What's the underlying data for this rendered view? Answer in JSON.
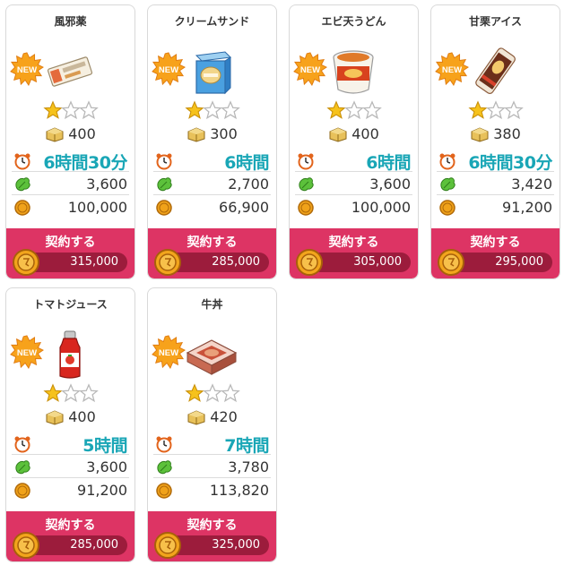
{
  "cards": [
    {
      "name": "風邪薬",
      "new_label": "NEW",
      "image_icon": "cold-medicine-box-icon",
      "stars_filled": 1,
      "stars_total": 3,
      "cost": "400",
      "time": "6時間30分",
      "leaf": "3,600",
      "coin": "100,000",
      "contract_label": "契約する",
      "price": "315,000"
    },
    {
      "name": "クリームサンド",
      "new_label": "NEW",
      "image_icon": "cream-sandwich-box-icon",
      "stars_filled": 1,
      "stars_total": 3,
      "cost": "300",
      "time": "6時間",
      "leaf": "2,700",
      "coin": "66,900",
      "contract_label": "契約する",
      "price": "285,000"
    },
    {
      "name": "エビ天うどん",
      "new_label": "NEW",
      "image_icon": "tempura-udon-cup-icon",
      "stars_filled": 1,
      "stars_total": 3,
      "cost": "400",
      "time": "6時間",
      "leaf": "3,600",
      "coin": "100,000",
      "contract_label": "契約する",
      "price": "305,000"
    },
    {
      "name": "甘栗アイス",
      "new_label": "NEW",
      "image_icon": "chestnut-ice-bar-icon",
      "stars_filled": 1,
      "stars_total": 3,
      "cost": "380",
      "time": "6時間30分",
      "leaf": "3,420",
      "coin": "91,200",
      "contract_label": "契約する",
      "price": "295,000"
    },
    {
      "name": "トマトジュース",
      "new_label": "NEW",
      "image_icon": "tomato-juice-bottle-icon",
      "stars_filled": 1,
      "stars_total": 3,
      "cost": "400",
      "time": "5時間",
      "leaf": "3,600",
      "coin": "91,200",
      "contract_label": "契約する",
      "price": "285,000"
    },
    {
      "name": "牛丼",
      "new_label": "NEW",
      "image_icon": "beef-bowl-box-icon",
      "stars_filled": 1,
      "stars_total": 3,
      "cost": "420",
      "time": "7時間",
      "leaf": "3,780",
      "coin": "113,820",
      "contract_label": "契約する",
      "price": "325,000"
    }
  ],
  "colors": {
    "contract_bg": "#dd3464",
    "price_pill": "#9c1c3c",
    "time_text": "#19a6b6",
    "star_gold": "#f6c21b",
    "new_badge": "#f7a21b"
  }
}
